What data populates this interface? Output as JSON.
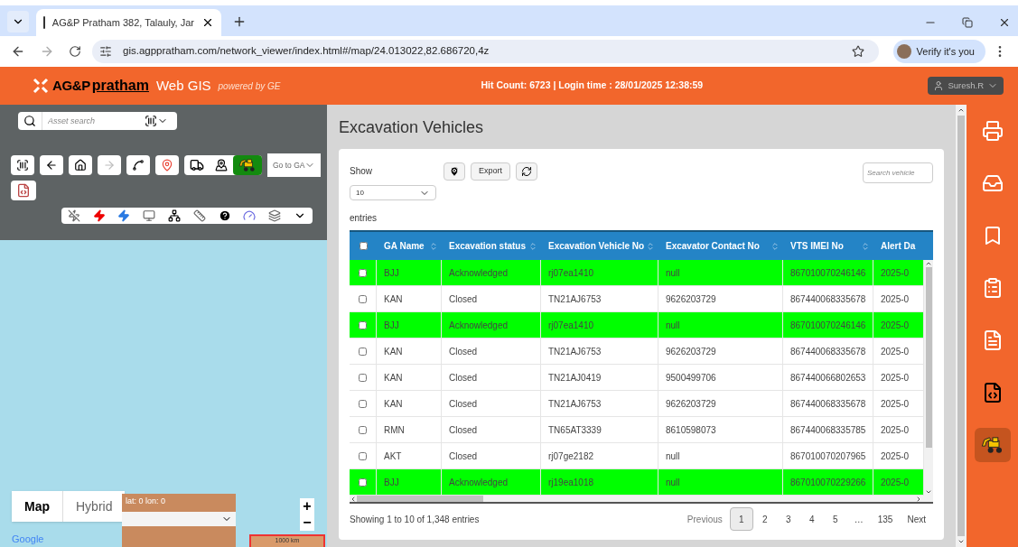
{
  "browser": {
    "tab_title": "AG&P Pratham 382, Talauly, Jar",
    "url": "gis.agppratham.com/network_viewer/index.html#/map/24.013022,82.686720,4z",
    "profile_button": "Verify it's you"
  },
  "header": {
    "logo_text": "AG&P",
    "logo_wordmark": "pratham",
    "app_name": "Web GIS",
    "powered_by": "powered by GE",
    "status": "Hit Count: 6723 | Login time : 28/01/2025 12:38:59",
    "user": "Suresh.R"
  },
  "map": {
    "search_placeholder": "Asset search",
    "goto": "Go to GA",
    "excavator_layer_on": true,
    "map_types": [
      {
        "label": "Map",
        "selected": true
      },
      {
        "label": "Hybrid",
        "selected": false
      }
    ],
    "coords": "lat: 0 lon: 0",
    "scale": "1000 km",
    "zoom_in": "+",
    "zoom_out": "−",
    "attribution": "Google"
  },
  "panel": {
    "title": "Excavation Vehicles",
    "show_label": "Show",
    "page_size": "10",
    "entries_label": "entries",
    "export": "Export",
    "search_placeholder": "Search vehicle",
    "select_all": {
      "checked": false
    },
    "columns": [
      "GA Name",
      "Excavation status",
      "Excavation Vehicle No",
      "Excavator Contact No",
      "VTS IMEI No",
      "Alert Da"
    ],
    "rows": [
      {
        "checked": false,
        "highlighted": true,
        "cells": [
          "BJJ",
          "Acknowledged",
          "rj07ea1410",
          "null",
          "867010070246146",
          "2025-0"
        ]
      },
      {
        "checked": false,
        "highlighted": false,
        "cells": [
          "KAN",
          "Closed",
          "TN21AJ6753",
          "9626203729",
          "867440068335678",
          "2025-0"
        ]
      },
      {
        "checked": false,
        "highlighted": true,
        "cells": [
          "BJJ",
          "Acknowledged",
          "rj07ea1410",
          "null",
          "867010070246146",
          "2025-0"
        ]
      },
      {
        "checked": false,
        "highlighted": false,
        "cells": [
          "KAN",
          "Closed",
          "TN21AJ6753",
          "9626203729",
          "867440068335678",
          "2025-0"
        ]
      },
      {
        "checked": false,
        "highlighted": false,
        "cells": [
          "KAN",
          "Closed",
          "TN21AJ0419",
          "9500499706",
          "867440066802653",
          "2025-0"
        ]
      },
      {
        "checked": false,
        "highlighted": false,
        "cells": [
          "KAN",
          "Closed",
          "TN21AJ6753",
          "9626203729",
          "867440068335678",
          "2025-0"
        ]
      },
      {
        "checked": false,
        "highlighted": false,
        "cells": [
          "RMN",
          "Closed",
          "TN65AT3339",
          "8610598073",
          "867440068335785",
          "2025-0"
        ]
      },
      {
        "checked": false,
        "highlighted": false,
        "cells": [
          "AKT",
          "Closed",
          "rj07ge2182",
          "null",
          "867010070207965",
          "2025-0"
        ]
      },
      {
        "checked": false,
        "highlighted": true,
        "cells": [
          "BJJ",
          "Acknowledged",
          "rj19ea1018",
          "null",
          "867010070229266",
          "2025-0"
        ]
      }
    ],
    "summary": "Showing 1 to 10 of 1,348 entries",
    "pagination": {
      "previous": "Previous",
      "next": "Next",
      "pages": [
        {
          "label": "1",
          "selected": true
        },
        {
          "label": "2",
          "selected": false
        },
        {
          "label": "3",
          "selected": false
        },
        {
          "label": "4",
          "selected": false
        },
        {
          "label": "5",
          "selected": false
        },
        {
          "label": "…",
          "selected": false
        },
        {
          "label": "135",
          "selected": false
        }
      ]
    }
  },
  "sidebar_tools": [
    {
      "kind": "print",
      "selected": false
    },
    {
      "kind": "download",
      "selected": false
    },
    {
      "kind": "bookmark",
      "selected": false
    },
    {
      "kind": "report",
      "selected": false
    },
    {
      "kind": "document",
      "selected": false
    },
    {
      "kind": "kml",
      "selected": false
    },
    {
      "kind": "excavator",
      "selected": true
    }
  ]
}
